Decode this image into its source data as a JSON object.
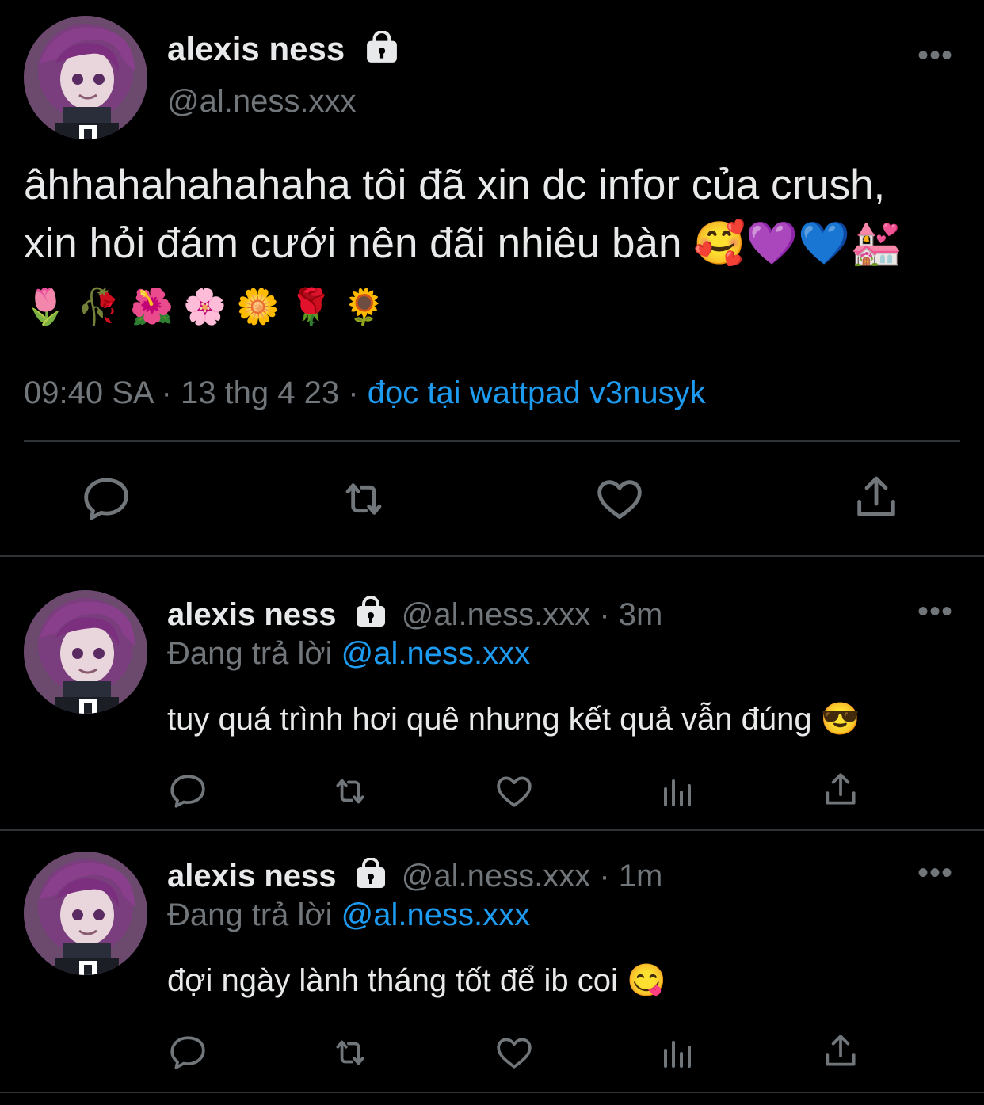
{
  "main_tweet": {
    "display_name": "alexis ness",
    "handle": "@al.ness.xxx",
    "text_line1": "âhhahahahahaha tôi đã xin dc infor của crush,",
    "text_line2": "xin hỏi đám cưới nên đãi nhiêu bàn 🥰💜💙💒",
    "text_line3": "🌷 🥀 🌺 🌸 🌼 🌹 🌻",
    "time": "09:40 SA",
    "date": "13 thg 4 23",
    "source": "đọc tại wattpad v3nusyk",
    "separator": "·"
  },
  "replies": [
    {
      "display_name": "alexis ness",
      "handle": "@al.ness.xxx",
      "age": "3m",
      "replying_label": "Đang trả lời",
      "replying_to": "@al.ness.xxx",
      "text": "tuy quá trình hơi quê nhưng kết quả vẫn đúng 😎",
      "separator": "·"
    },
    {
      "display_name": "alexis ness",
      "handle": "@al.ness.xxx",
      "age": "1m",
      "replying_label": "Đang trả lời",
      "replying_to": "@al.ness.xxx",
      "text": "đợi ngày lành tháng tốt để ib coi 😋",
      "separator": "·"
    }
  ],
  "more_glyph": "•••",
  "colors": {
    "background": "#000000",
    "text": "#e7e9ea",
    "muted": "#71767b",
    "link": "#1d9bf0",
    "divider": "#2f3336"
  },
  "icons": [
    "lock-icon",
    "reply-icon",
    "retweet-icon",
    "like-icon",
    "views-icon",
    "share-icon",
    "more-icon"
  ]
}
